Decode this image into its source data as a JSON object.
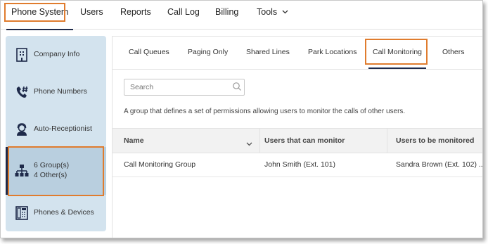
{
  "topnav": {
    "items": [
      {
        "label": "Phone System"
      },
      {
        "label": "Users"
      },
      {
        "label": "Reports"
      },
      {
        "label": "Call Log"
      },
      {
        "label": "Billing"
      },
      {
        "label": "Tools"
      }
    ]
  },
  "sidebar": {
    "items": [
      {
        "label": "Company Info",
        "icon": "building-icon"
      },
      {
        "label": "Phone Numbers",
        "icon": "phone-hash-icon"
      },
      {
        "label": "Auto-Receptionist",
        "icon": "headset-icon"
      },
      {
        "label": "6 Group(s)",
        "label2": "4 Other(s)",
        "icon": "org-chart-icon"
      },
      {
        "label": "Phones & Devices",
        "icon": "desk-phone-icon"
      }
    ]
  },
  "subtabs": [
    {
      "label": "Call Queues"
    },
    {
      "label": "Paging Only"
    },
    {
      "label": "Shared Lines"
    },
    {
      "label": "Park Locations"
    },
    {
      "label": "Call Monitoring"
    },
    {
      "label": "Others"
    }
  ],
  "search": {
    "placeholder": "Search"
  },
  "description": "A group that defines a set of permissions allowing users to monitor the calls of other users.",
  "table": {
    "headers": [
      "Name",
      "Users that can monitor",
      "Users to be monitored"
    ],
    "rows": [
      [
        "Call Monitoring Group",
        "John Smith (Ext. 101)",
        "Sandra Brown (Ext. 102) ..."
      ]
    ]
  },
  "colors": {
    "highlight": "#e07c2e",
    "sidebar_bg": "#d3e3ee",
    "active_bar": "#1e2a4a"
  }
}
